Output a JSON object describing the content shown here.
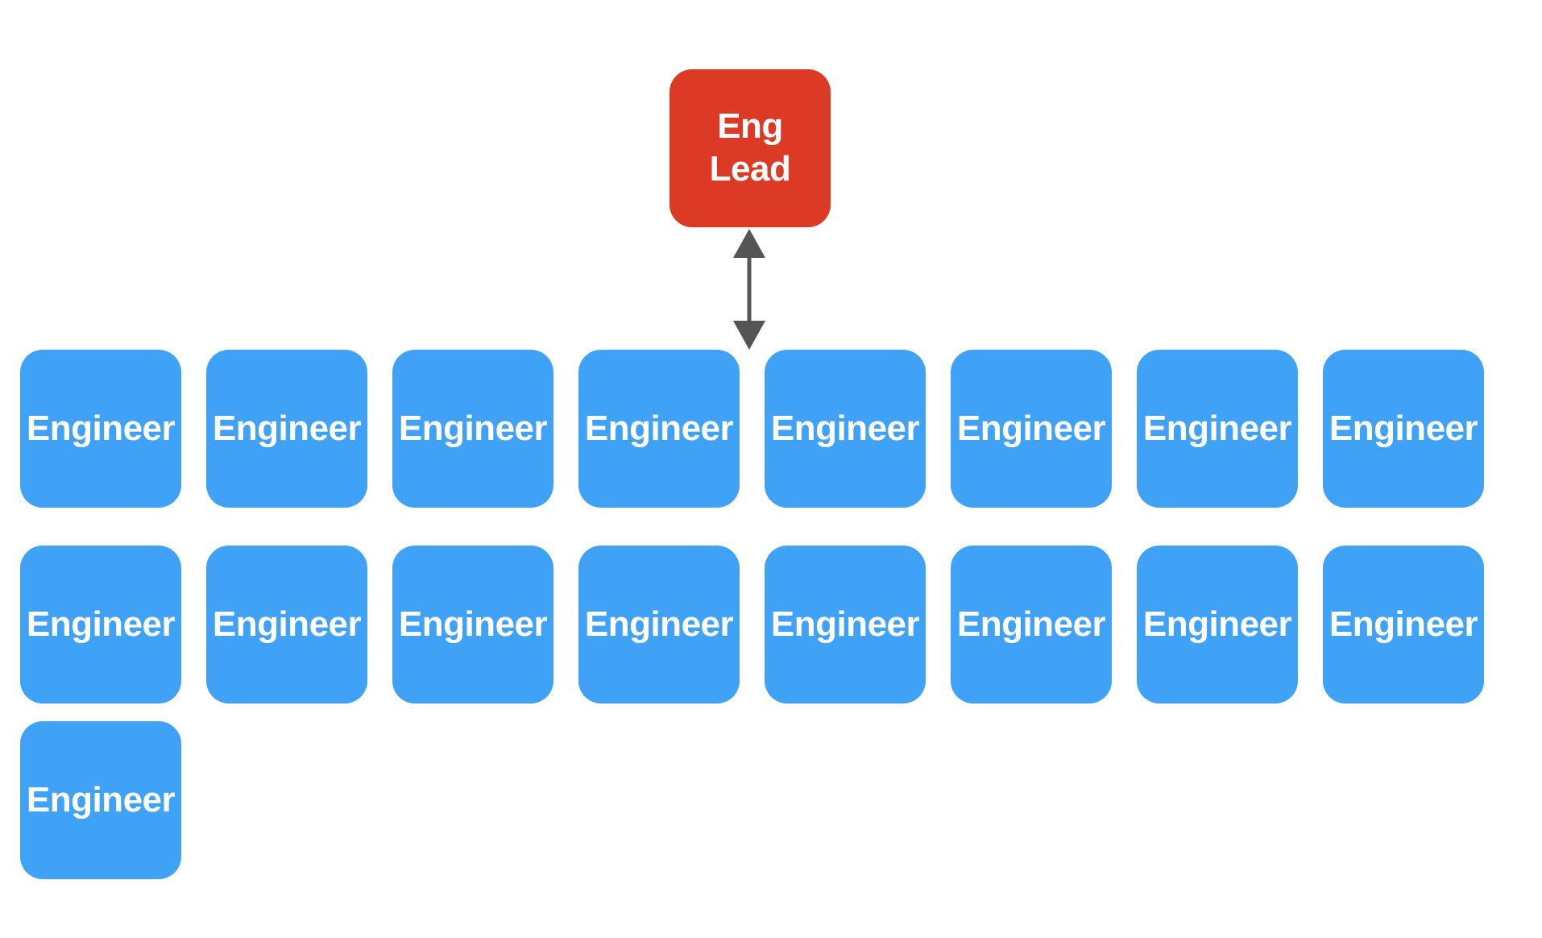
{
  "lead": {
    "label": "Eng\nLead",
    "color": "#dc3a25"
  },
  "engineers": {
    "label": "Engineer",
    "color": "#3fa2f7",
    "rows": [
      8,
      8,
      1
    ]
  },
  "connector": {
    "type": "double-arrow",
    "color": "#555555",
    "from": "lead",
    "to": "engineers"
  }
}
